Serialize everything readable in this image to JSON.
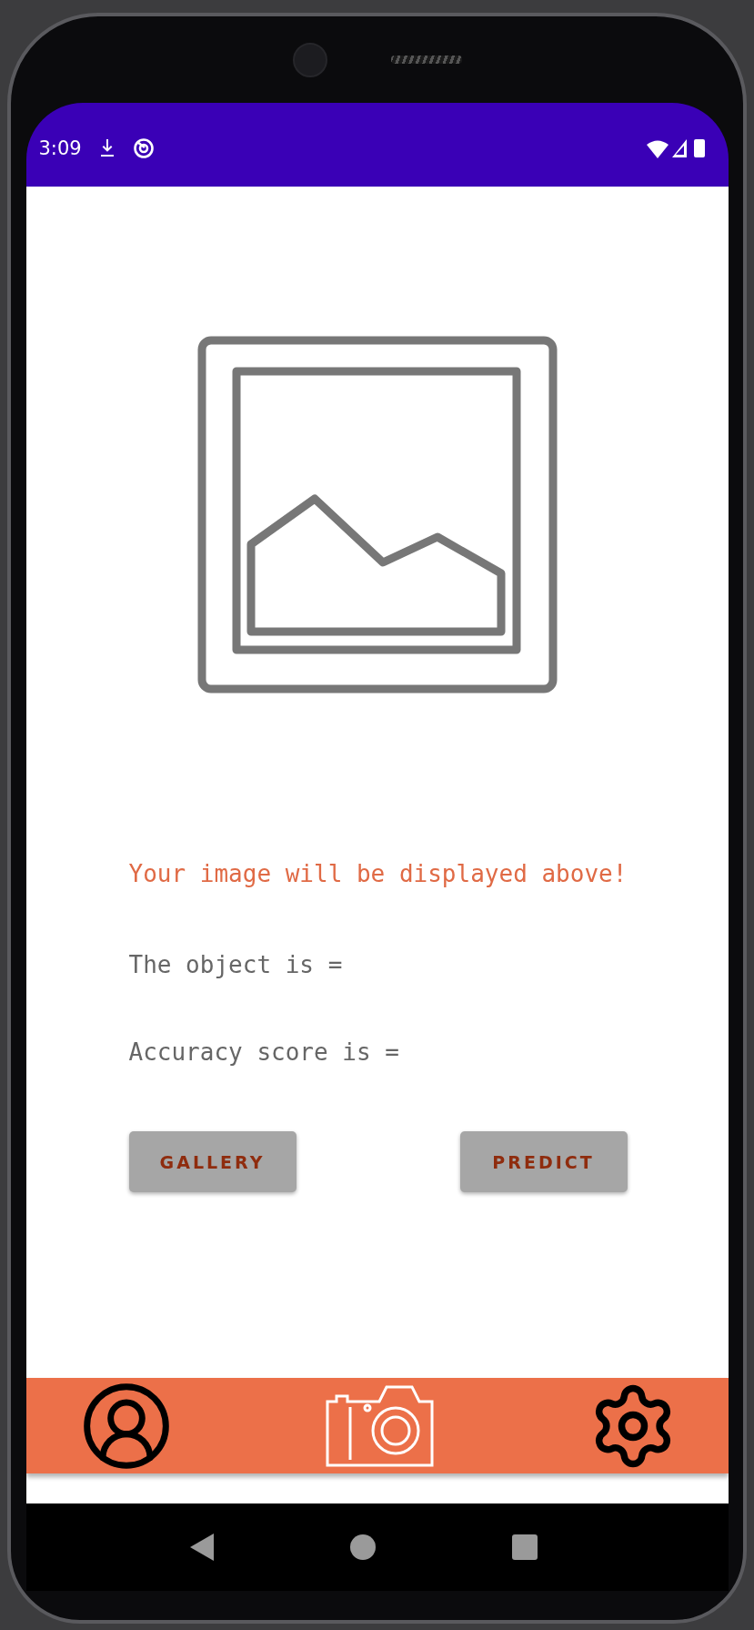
{
  "status_bar": {
    "time": "3:09"
  },
  "message": "Your image will be displayed above!",
  "results": [
    "The object is =",
    "Accuracy score is ="
  ],
  "buttons": [
    {
      "label": "GALLERY",
      "disabled": true
    },
    {
      "label": "PREDICT",
      "disabled": true
    }
  ],
  "bottom_nav": [
    {
      "kind": "profile",
      "selected": false
    },
    {
      "kind": "camera",
      "selected": true
    },
    {
      "kind": "settings",
      "selected": false
    }
  ]
}
